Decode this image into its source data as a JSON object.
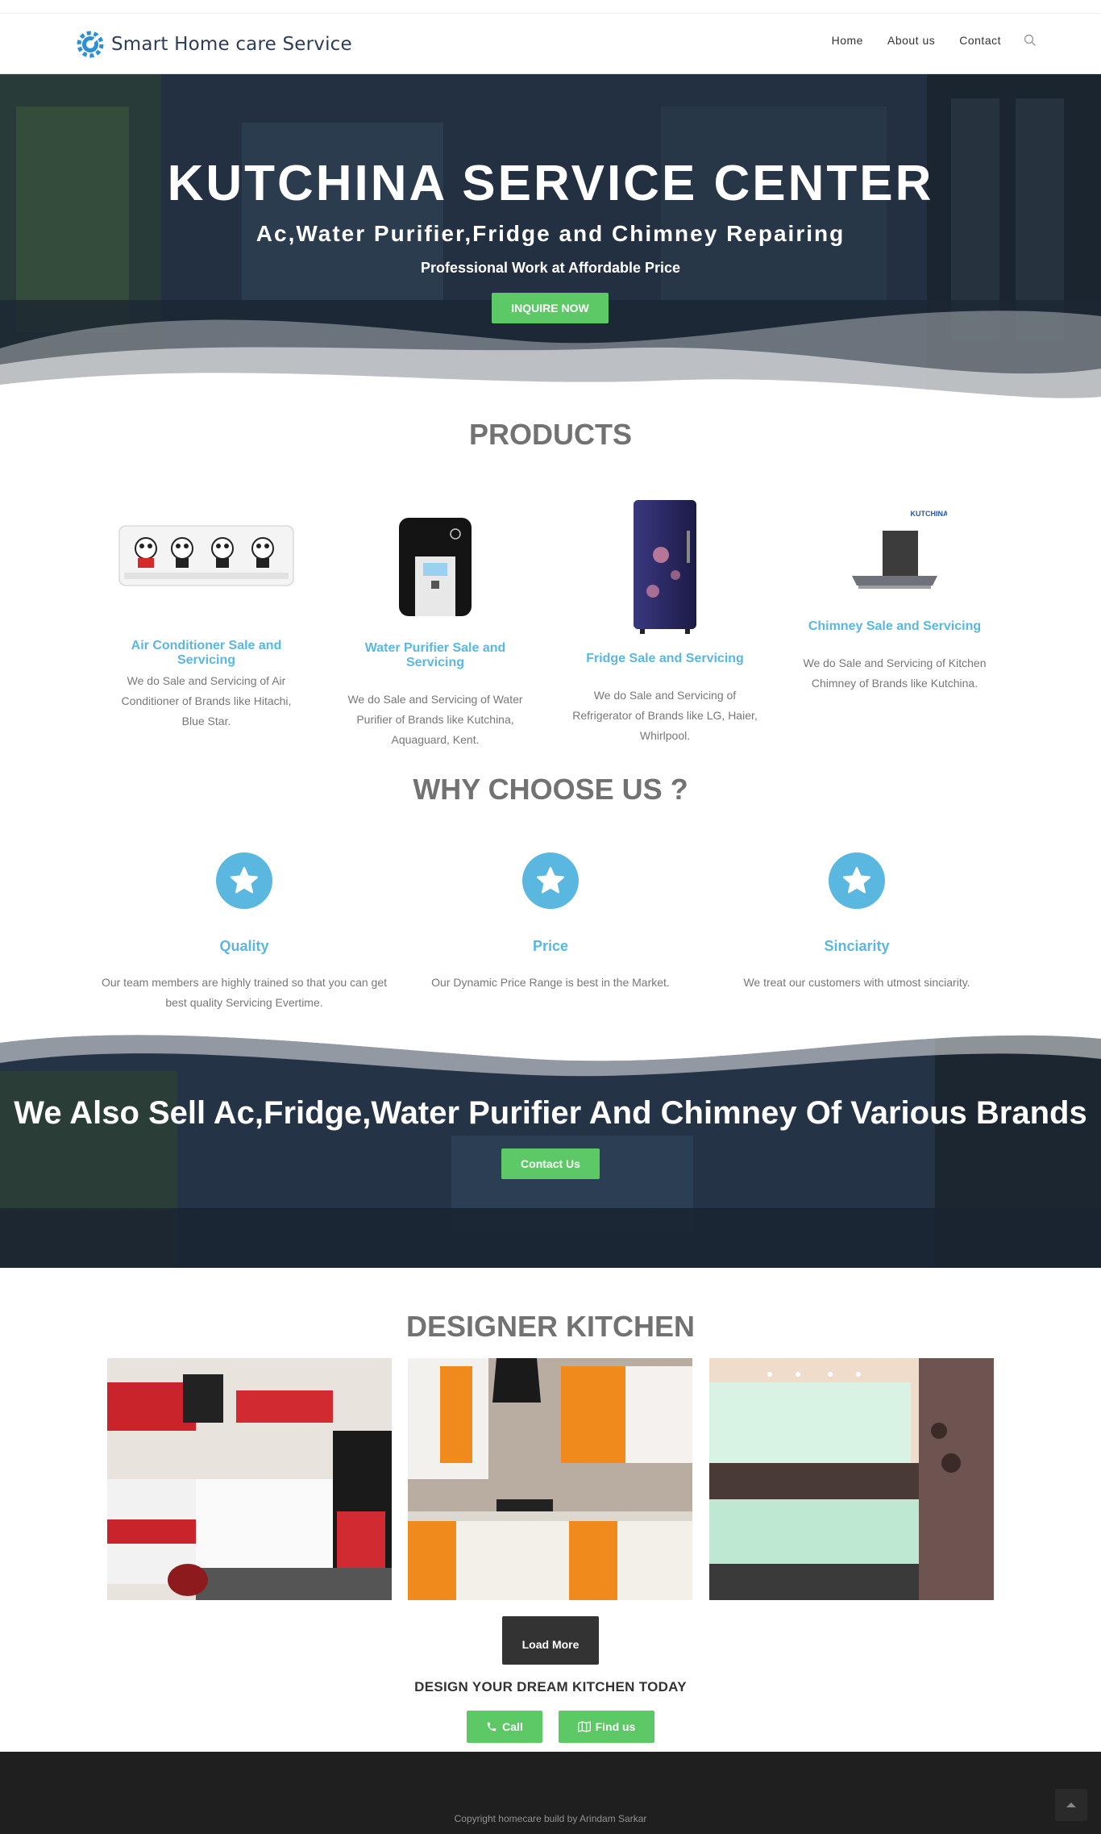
{
  "header": {
    "logo_text": "Smart Home care Service",
    "nav": [
      {
        "label": "Home"
      },
      {
        "label": "About us"
      },
      {
        "label": "Contact"
      }
    ],
    "search_icon": "search-icon"
  },
  "hero": {
    "title": "KUTCHINA SERVICE CENTER",
    "subtitle": "Ac,Water Purifier,Fridge and Chimney Repairing",
    "tagline": "Professional Work at Affordable Price",
    "button": "INQUIRE NOW"
  },
  "products": {
    "heading": "PRODUCTS",
    "items": [
      {
        "title": "Air Conditioner Sale and Servicing",
        "desc": "We do Sale and Servicing of Air Conditioner of Brands like Hitachi, Blue Star."
      },
      {
        "title": "Water Purifier Sale and Servicing",
        "desc": "We do Sale and Servicing of Water Purifier of Brands like Kutchina, Aquaguard, Kent."
      },
      {
        "title": "Fridge Sale and Servicing",
        "desc": "We do Sale and Servicing of Refrigerator of Brands like LG, Haier, Whirlpool."
      },
      {
        "title": "Chimney Sale and Servicing",
        "desc": "We do Sale and Servicing of Kitchen Chimney of Brands like Kutchina."
      }
    ],
    "chimney_brand": "KUTCHINA"
  },
  "why": {
    "heading": "WHY CHOOSE US ?",
    "items": [
      {
        "title": "Quality",
        "desc": "Our team members are highly trained so that you can get best quality Servicing Evertime."
      },
      {
        "title": "Price",
        "desc": "Our Dynamic Price Range is best in the Market."
      },
      {
        "title": "Sinciarity",
        "desc": "We treat our customers with utmost sinciarity."
      }
    ]
  },
  "band": {
    "title": "We Also Sell Ac,Fridge,Water Purifier And Chimney Of Various Brands",
    "button": "Contact Us"
  },
  "kitchen": {
    "heading": "DESIGNER KITCHEN",
    "load_more": "Load More",
    "dream": "DESIGN YOUR DREAM KITCHEN TODAY",
    "call": "Call",
    "find": "Find us"
  },
  "footer": {
    "copyright": "Copyright homecare build by Arindam Sarkar"
  },
  "colors": {
    "accent": "#5ab7e0",
    "button_green": "#5cc966",
    "footer_bg": "#1f1f1f"
  }
}
